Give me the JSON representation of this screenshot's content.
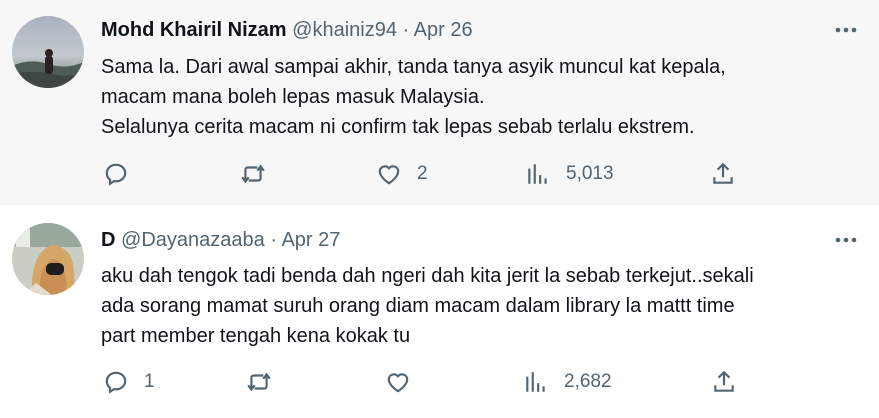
{
  "tweets": [
    {
      "name": "Mohd Khairil Nizam",
      "handle": "@khainiz94",
      "separator": "·",
      "date": "Apr 26",
      "lines": [
        "Sama la. Dari awal sampai akhir, tanda tanya asyik muncul kat kepala,",
        "macam mana boleh lepas masuk Malaysia.",
        "Selalunya cerita macam ni confirm tak lepas sebab terlalu ekstrem."
      ],
      "reply_count": "",
      "retweet_count": "",
      "like_count": "2",
      "view_count": "5,013"
    },
    {
      "name": "D",
      "handle": "@Dayanazaaba",
      "separator": "·",
      "date": "Apr 27",
      "lines": [
        "aku dah tengok tadi benda dah ngeri dah kita jerit la sebab terkejut..sekali",
        "ada sorang mamat suruh orang diam macam dalam library la mattt time",
        "part member tengah kena kokak tu"
      ],
      "reply_count": "1",
      "retweet_count": "",
      "like_count": "",
      "view_count": "2,682"
    }
  ],
  "icons": {
    "reply": "reply-icon",
    "retweet": "retweet-icon",
    "like": "heart-icon",
    "views": "views-icon",
    "share": "share-icon",
    "more": "more-icon"
  },
  "colors": {
    "text": "#0f1419",
    "muted": "#536471",
    "highlight_bg": "#f7f7f7",
    "divider": "#eff3f4"
  }
}
